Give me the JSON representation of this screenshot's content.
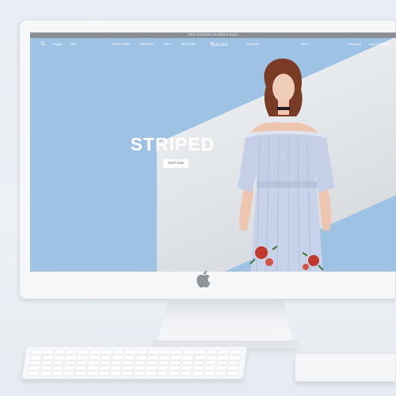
{
  "site": {
    "promo_bar": "FREE SHIPPING ON ORDER $100+",
    "brand": "Rainer",
    "nav_left": [
      "English",
      "USD"
    ],
    "nav_menu": [
      "WHAT'S NEW",
      "DRESSES",
      "TOPS",
      "BOTTOMS",
      "JEWELRY",
      "SALE"
    ],
    "nav_right": [
      "Check Bag",
      "Sign In/Register"
    ]
  },
  "hero": {
    "title": "STRIPED",
    "cta_label": "SHOP NOW"
  },
  "icons": {
    "search": "search-icon",
    "device_logo": "apple-logo-icon"
  },
  "colors": {
    "sky": "#9ec2e4",
    "topbar": "#8a8f96",
    "dress": "#c5cfe6"
  }
}
